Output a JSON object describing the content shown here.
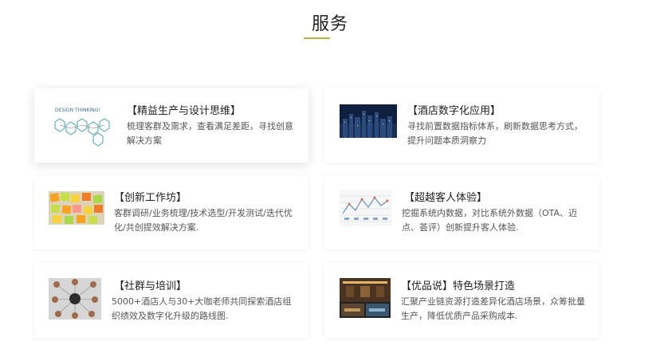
{
  "section_title": "服务",
  "accent_color": "#a7c03a",
  "cards": [
    {
      "title": "【精益生产与设计思维】",
      "desc": "梳理客群及需求，查看满足差距，寻找创意解决方案",
      "thumb_text": "DESIGN THINKING!",
      "icon": "design-thinking-icon"
    },
    {
      "title": "【酒店数字化应用】",
      "desc": "寻找前置数据指标体系，刷新数据思考方式，提升问题本质洞察力",
      "icon": "city-night-image"
    },
    {
      "title": "【创新工作坊】",
      "desc": "客群调研/业务梳理/技术选型/开发测试/迭代优化/共创提效解决方案.",
      "icon": "sticky-notes-image"
    },
    {
      "title": "【超越客人体验】",
      "desc": "挖掘系统内数据，对比系统外数据（OTA、迈点、荟评）创新提升客人体验.",
      "icon": "journey-map-image"
    },
    {
      "title": "【社群与培训】",
      "desc": "5000+酒店人与30+大咖老师共同探索酒店组织绩效及数字化升级的路线图.",
      "icon": "network-people-image"
    },
    {
      "title": "【优品说】特色场景打造",
      "desc": "汇聚产业链资源打造差异化酒店场景，众筹批量生产，降低优质产品采购成本.",
      "icon": "hotel-lobby-image"
    }
  ]
}
